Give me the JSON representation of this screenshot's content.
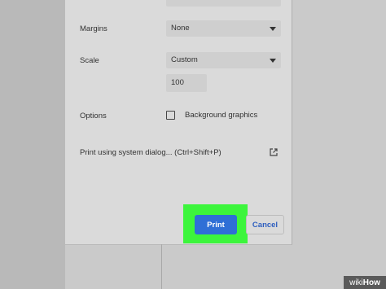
{
  "print_dialog": {
    "margins": {
      "label": "Margins",
      "value": "None"
    },
    "scale": {
      "label": "Scale",
      "value": "Custom",
      "custom_value": "100"
    },
    "options": {
      "label": "Options",
      "background_graphics": {
        "label": "Background graphics",
        "checked": false
      }
    },
    "system_dialog": {
      "label": "Print using system dialog... (Ctrl+Shift+P)",
      "icon": "open-external-icon"
    },
    "buttons": {
      "print": "Print",
      "cancel": "Cancel"
    }
  },
  "highlight_color": "#3cf53c",
  "accent_color": "#2f6fd6",
  "watermark": {
    "prefix": "wiki",
    "suffix": "How"
  }
}
